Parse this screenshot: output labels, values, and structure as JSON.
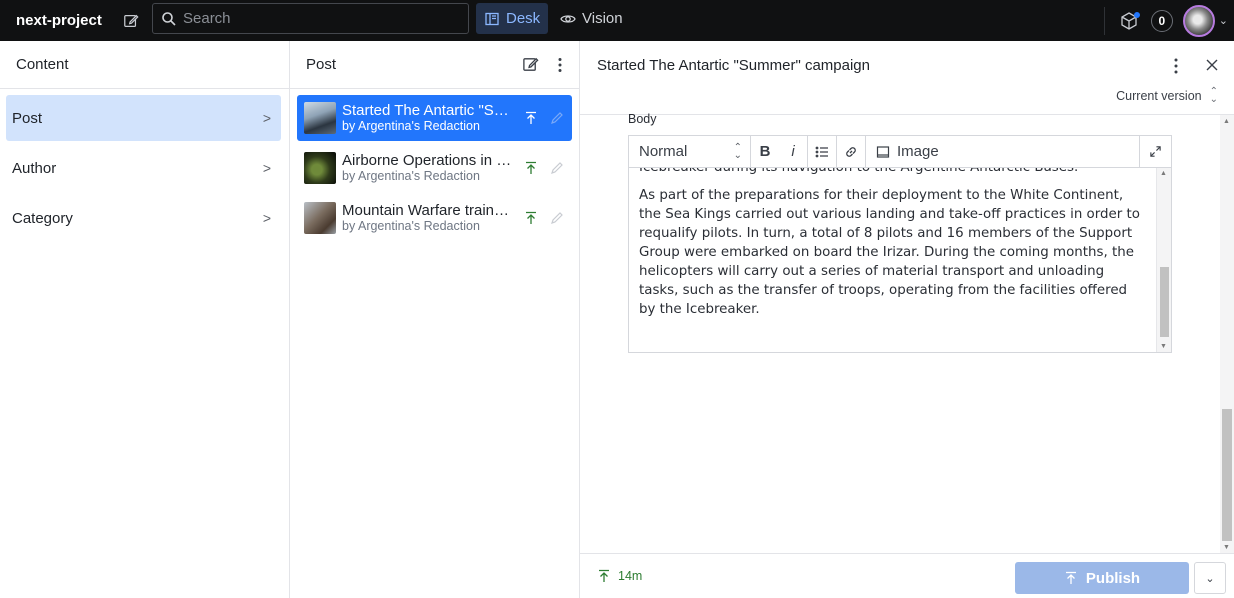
{
  "topbar": {
    "project_name": "next-project",
    "search_placeholder": "Search",
    "tools": [
      {
        "label": "Desk",
        "active": true
      },
      {
        "label": "Vision",
        "active": false
      }
    ],
    "notification_count": "0"
  },
  "content_pane": {
    "title": "Content",
    "items": [
      {
        "label": "Post",
        "selected": true
      },
      {
        "label": "Author",
        "selected": false
      },
      {
        "label": "Category",
        "selected": false
      }
    ]
  },
  "post_pane": {
    "title": "Post",
    "documents": [
      {
        "title": "Started The Antartic \"Summer\" campaign",
        "subtitle": "by Argentina's Redaction",
        "selected": true
      },
      {
        "title": "Airborne Operations in Corrientes",
        "subtitle": "by Argentina's Redaction",
        "selected": false
      },
      {
        "title": "Mountain Warfare training",
        "subtitle": "by Argentina's Redaction",
        "selected": false
      }
    ]
  },
  "editor": {
    "document_title": "Started The Antartic \"Summer\" campaign",
    "version_label": "Current version",
    "field_label": "Body",
    "toolbar": {
      "block_style": "Normal",
      "bold": "B",
      "italic": "i",
      "image_label": "Image"
    },
    "cut_line": "Icebreaker during its navigation to the Argentine Antarctic Bases.",
    "paragraph": "As part of the preparations for their deployment to the White Continent, the Sea Kings carried out various landing and take-off practices in order to requalify pilots. In turn, a total of 8 pilots and 16 members of the Support Group were embarked on board the Irizar. During the coming months, the helicopters will carry out a series of material transport and unloading tasks, such as the transfer of troops, operating from the facilities offered by the Icebreaker."
  },
  "footer": {
    "published_ago": "14m",
    "publish_label": "Publish"
  },
  "colors": {
    "topbar_bg": "#101112",
    "accent": "#2276fc",
    "selected_nav": "#d2e3fc",
    "published_green": "#2e7d32",
    "publish_disabled": "#9bb8e8"
  }
}
